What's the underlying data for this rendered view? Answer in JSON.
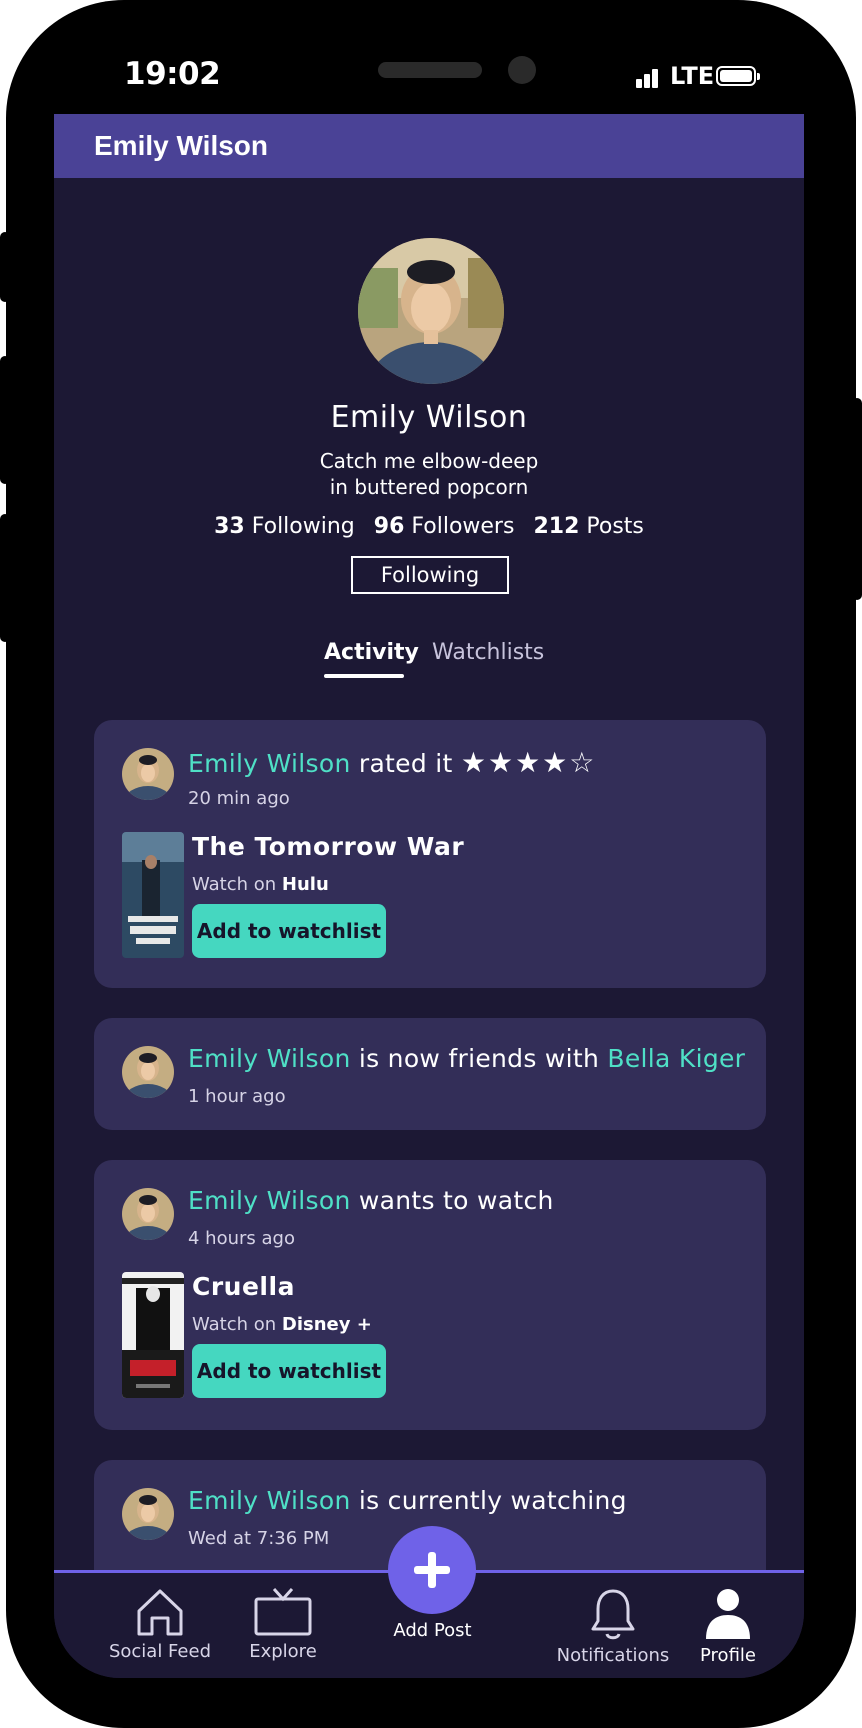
{
  "status_bar": {
    "time": "19:02",
    "network": "LTE"
  },
  "app_bar": {
    "title": "Emily Wilson"
  },
  "profile": {
    "name": "Emily Wilson",
    "bio_line1": "Catch me elbow-deep",
    "bio_line2": "in buttered popcorn",
    "following_count": "33",
    "following_label": "Following",
    "followers_count": "96",
    "followers_label": "Followers",
    "posts_count": "212",
    "posts_label": "Posts",
    "follow_button": "Following"
  },
  "tabs": {
    "activity": "Activity",
    "watchlists": "Watchlists"
  },
  "feed": [
    {
      "user": "Emily Wilson",
      "action": "rated it",
      "rating": 4,
      "rating_max": 5,
      "stars": "★★★★☆",
      "time": "20 min ago",
      "movie_title": "The Tomorrow War",
      "watch_on_prefix": "Watch on",
      "service": "Hulu",
      "button": "Add to watchlist"
    },
    {
      "user": "Emily Wilson",
      "action": "is now friends with",
      "friend": "Bella Kiger",
      "time": "1 hour ago"
    },
    {
      "user": "Emily Wilson",
      "action": "wants to watch",
      "time": "4 hours ago",
      "movie_title": "Cruella",
      "watch_on_prefix": "Watch on",
      "service": "Disney +",
      "button": "Add to watchlist"
    },
    {
      "user": "Emily Wilson",
      "action": "is currently watching",
      "time": "Wed at 7:36 PM"
    }
  ],
  "bottom_nav": {
    "social_feed": "Social Feed",
    "explore": "Explore",
    "add_post": "Add Post",
    "notifications": "Notifications",
    "profile": "Profile"
  },
  "colors": {
    "background": "#1c1834",
    "app_bar": "#4a4296",
    "card": "#332e58",
    "highlight": "#4fe0c6",
    "button": "#45d7c0",
    "accent": "#6f62e8"
  }
}
